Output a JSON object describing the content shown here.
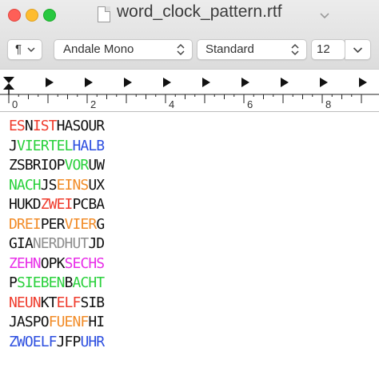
{
  "window": {
    "title": "word_clock_pattern.rtf",
    "buttons": [
      "close",
      "minimize",
      "zoom"
    ]
  },
  "toolbar": {
    "paragraph_symbol": "¶",
    "font_family": "Andale Mono",
    "font_style": "Standard",
    "font_size": "12"
  },
  "ruler": {
    "labels": [
      "0",
      "2",
      "4",
      "6",
      "8"
    ]
  },
  "colors": {
    "black": "#111111",
    "red": "#ef3b2c",
    "green": "#2ad13c",
    "blue": "#2d4fe0",
    "orange": "#f28c28",
    "grey": "#8e8e8e",
    "magenta": "#e82ee8"
  },
  "document": {
    "rows": [
      [
        {
          "t": "ES",
          "c": "red"
        },
        {
          "t": "N",
          "c": "black"
        },
        {
          "t": "IST",
          "c": "red"
        },
        {
          "t": "HASOUR",
          "c": "black"
        }
      ],
      [
        {
          "t": "J",
          "c": "black"
        },
        {
          "t": "VIERTEL",
          "c": "green"
        },
        {
          "t": "HALB",
          "c": "blue"
        }
      ],
      [
        {
          "t": "ZSBRIOP",
          "c": "black"
        },
        {
          "t": "VOR",
          "c": "green"
        },
        {
          "t": "UW",
          "c": "black"
        }
      ],
      [
        {
          "t": "NACH",
          "c": "green"
        },
        {
          "t": "JS",
          "c": "black"
        },
        {
          "t": "EINS",
          "c": "orange"
        },
        {
          "t": "UX",
          "c": "black"
        }
      ],
      [
        {
          "t": "HUKD",
          "c": "black"
        },
        {
          "t": "ZWEI",
          "c": "red"
        },
        {
          "t": "PCBA",
          "c": "black"
        }
      ],
      [
        {
          "t": "DREI",
          "c": "orange"
        },
        {
          "t": "PER",
          "c": "black"
        },
        {
          "t": "VIER",
          "c": "orange"
        },
        {
          "t": "G",
          "c": "black"
        }
      ],
      [
        {
          "t": "GIA",
          "c": "black"
        },
        {
          "t": "NERDHUT",
          "c": "grey"
        },
        {
          "t": "JD",
          "c": "black"
        }
      ],
      [
        {
          "t": "ZEHN",
          "c": "magenta"
        },
        {
          "t": "OPK",
          "c": "black"
        },
        {
          "t": "SECHS",
          "c": "magenta"
        }
      ],
      [
        {
          "t": "P",
          "c": "black"
        },
        {
          "t": "SIEBEN",
          "c": "green"
        },
        {
          "t": "B",
          "c": "black"
        },
        {
          "t": "ACHT",
          "c": "green"
        }
      ],
      [
        {
          "t": "NEUN",
          "c": "red"
        },
        {
          "t": "KT",
          "c": "black"
        },
        {
          "t": "ELF",
          "c": "red"
        },
        {
          "t": "SIB",
          "c": "black"
        }
      ],
      [
        {
          "t": "JASPO",
          "c": "black"
        },
        {
          "t": "FUENF",
          "c": "orange"
        },
        {
          "t": "HI",
          "c": "black"
        }
      ],
      [
        {
          "t": "ZWOELF",
          "c": "blue"
        },
        {
          "t": "JFP",
          "c": "black"
        },
        {
          "t": "UHR",
          "c": "blue"
        }
      ]
    ]
  }
}
